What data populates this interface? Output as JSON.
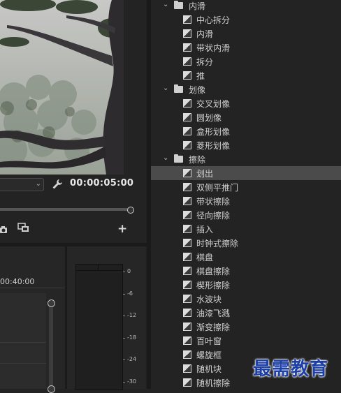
{
  "monitor": {
    "timecode": "00:00:05:00",
    "fit_value": ""
  },
  "timeline": {
    "ruler_label": "00:40:00"
  },
  "audio_meter": {
    "scale": [
      "0",
      "-6",
      "-12",
      "-18",
      "-24",
      "-30"
    ]
  },
  "effects_tree": {
    "folders": [
      {
        "label": "内滑",
        "items": [
          "中心拆分",
          "内滑",
          "带状内滑",
          "拆分",
          "推"
        ]
      },
      {
        "label": "划像",
        "items": [
          "交叉划像",
          "圆划像",
          "盒形划像",
          "菱形划像"
        ]
      },
      {
        "label": "擦除",
        "items": [
          "划出",
          "双侧平推门",
          "带状擦除",
          "径向擦除",
          "插入",
          "时钟式擦除",
          "棋盘",
          "棋盘擦除",
          "楔形擦除",
          "水波块",
          "油漆飞溅",
          "渐变擦除",
          "百叶窗",
          "螺旋框",
          "随机块",
          "随机擦除"
        ]
      }
    ],
    "selected_item": "划出"
  },
  "watermark": "最需教育",
  "icons": {
    "folder": "folder-icon",
    "effect": "transition-effect-icon",
    "expand": "chevron-down-icon",
    "wrench": "wrench-icon",
    "camera": "camera-icon",
    "multicam": "multi-camera-icon",
    "add": "plus-icon"
  }
}
